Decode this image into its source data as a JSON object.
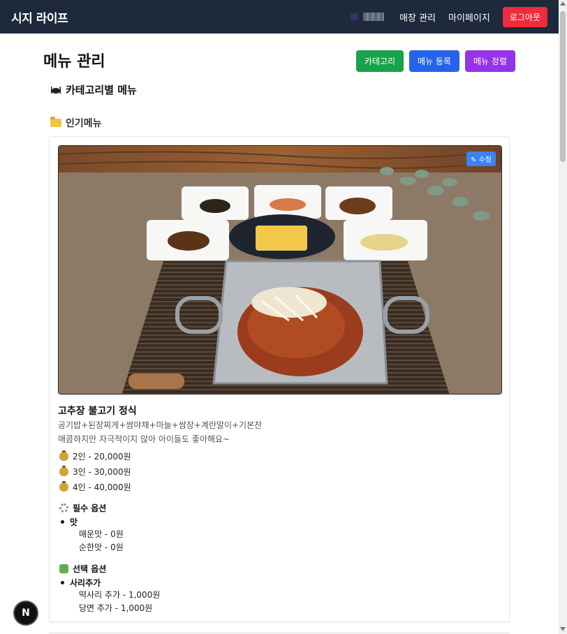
{
  "navbar": {
    "brand": "시지 라이프",
    "links": [
      "매장 관리",
      "마이페이지"
    ],
    "logout_label": "로그아웃"
  },
  "header": {
    "title": "메뉴 관리",
    "buttons": [
      "카테고리",
      "메뉴 등록",
      "메뉴 정렬"
    ]
  },
  "section": {
    "title": "카테고리별 메뉴",
    "icon": "bowl-icon"
  },
  "category": {
    "name": "인기메뉴",
    "icon": "folder-icon"
  },
  "menu": {
    "edit_label": "수정",
    "name": "고추장 불고기 정식",
    "desc_line1": "공기밥+된장찌게+쌈야채+마늘+쌈장+계란말이+기본찬",
    "desc_line2": "매콤하지만 자극적이지 않아 아이들도 좋아해요~",
    "prices": [
      "2인 - 20,000원",
      "3인 - 30,000원",
      "4인 - 40,000원"
    ],
    "required_options": {
      "title": "필수 옵션",
      "group": "맛",
      "items": [
        "매운맛 - 0원",
        "순한맛 - 0원"
      ]
    },
    "optional_options": {
      "title": "선택 옵션",
      "group": "사리추가",
      "items": [
        "떡사리 추가 - 1,000원",
        "당면 추가 - 1,000원"
      ]
    }
  },
  "dev_badge": "N",
  "colors": {
    "navbar": "#1e2a3b",
    "logout": "#ef2b3c",
    "btn_category": "#16a34a",
    "btn_register": "#2563eb",
    "btn_sort": "#9333ea",
    "edit_badge": "#3b82f6"
  }
}
